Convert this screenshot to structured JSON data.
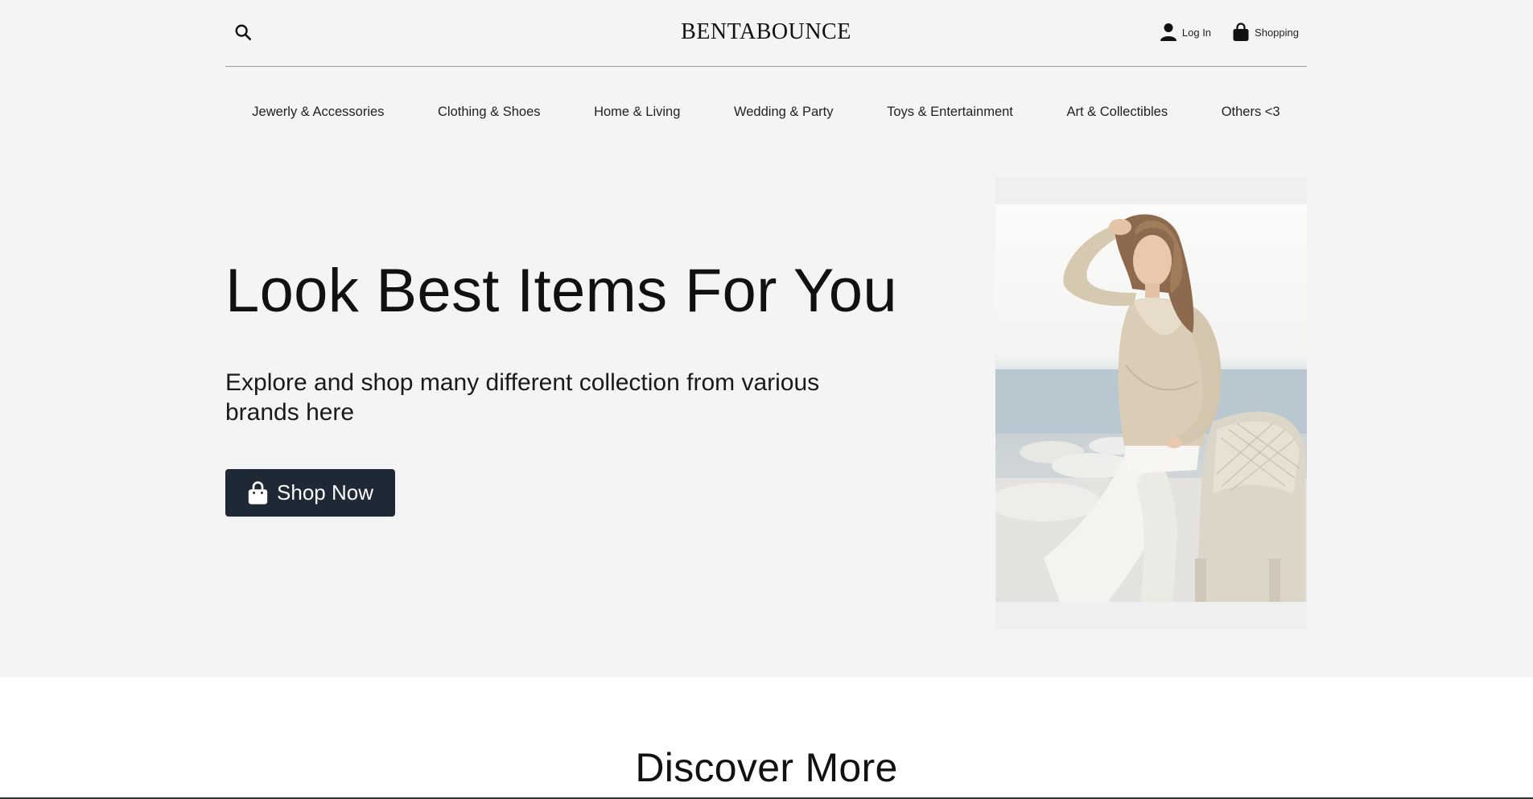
{
  "header": {
    "brand": "BENTABOUNCE",
    "login_label": "Log In",
    "shopping_label": "Shopping"
  },
  "nav": {
    "items": [
      "Jewerly & Accessories",
      "Clothing & Shoes",
      "Home & Living",
      "Wedding & Party",
      "Toys & Entertainment",
      "Art & Collectibles",
      "Others <3"
    ]
  },
  "hero": {
    "title": "Look Best Items For You",
    "subtitle": "Explore and shop many different collection from various brands here",
    "cta_label": "Shop Now"
  },
  "discover": {
    "title": "Discover More"
  },
  "colors": {
    "hero_bg": "#f4f4f4",
    "button_bg": "#1f2935",
    "text": "#111111"
  },
  "icons": {
    "search": "search-icon",
    "user": "user-icon",
    "bag": "shopping-bag-icon"
  }
}
